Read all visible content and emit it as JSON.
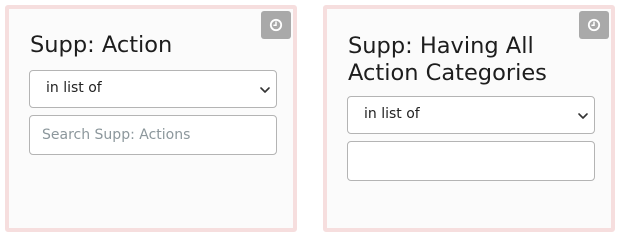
{
  "cards": [
    {
      "title": "Supp: Action",
      "operator": "in list of",
      "input_value": "",
      "input_placeholder": "Search Supp: Actions",
      "history_icon": "clock-icon"
    },
    {
      "title": "Supp: Having All Action Categories",
      "operator": "in list of",
      "input_value": "",
      "input_placeholder": "",
      "history_icon": "clock-icon"
    }
  ],
  "colors": {
    "card_border": "#f6dede",
    "history_button": "#a9a9a9",
    "placeholder": "#8c979c"
  }
}
